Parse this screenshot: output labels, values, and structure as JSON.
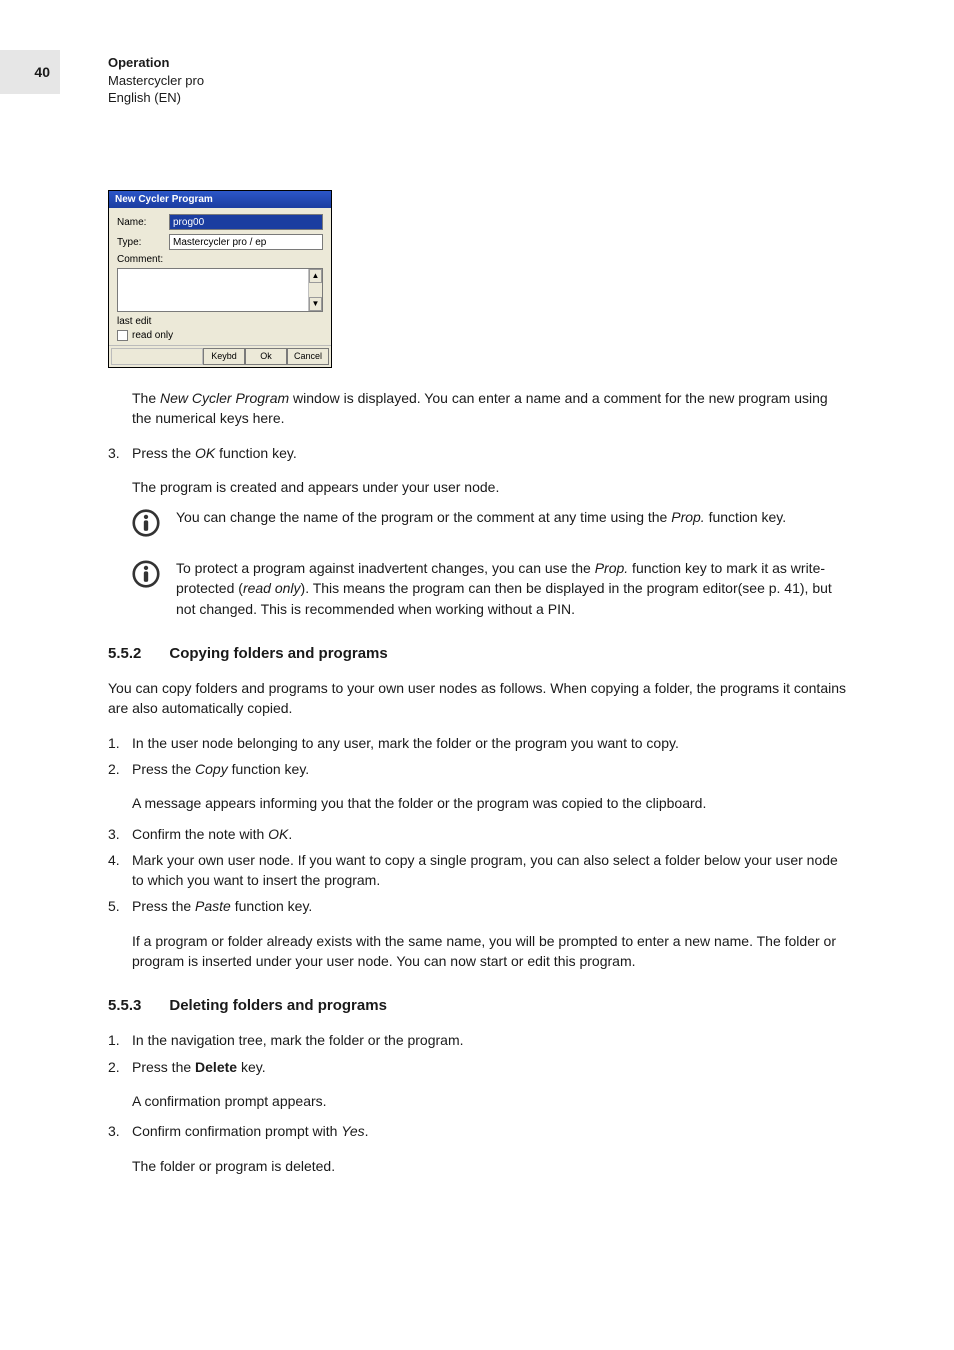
{
  "page_number": "40",
  "header": {
    "title": "Operation",
    "line2": "Mastercycler pro",
    "line3": "English (EN)"
  },
  "dialog": {
    "title": "New Cycler Program",
    "labels": {
      "name": "Name:",
      "type": "Type:",
      "comment": "Comment:",
      "last_edit": "last edit",
      "read_only": "read only"
    },
    "values": {
      "name": "prog00",
      "type": "Mastercycler pro / ep"
    },
    "buttons": {
      "keybd": "Keybd",
      "ok": "Ok",
      "cancel": "Cancel"
    }
  },
  "body": {
    "p1_a": "The ",
    "p1_b": "New Cycler Program",
    "p1_c": " window is displayed. You can enter a name and a comment for the new program using the numerical keys here.",
    "step3_num": "3.",
    "step3_a": "Press the ",
    "step3_b": "OK",
    "step3_c": " function key.",
    "step3_sub": "The program is created and appears under your user node.",
    "info1_a": "You can change the name of the program or the comment at any time using the ",
    "info1_b": "Prop.",
    "info1_c": " function key.",
    "info2_a": "To protect a program against inadvertent changes, you can use the ",
    "info2_b": "Prop.",
    "info2_c": " function key to mark it as write-protected (",
    "info2_d": "read only",
    "info2_e": "). This means the program can then be displayed in the program editor(see p. 41), but not changed. This is recommended when working without a PIN."
  },
  "sec552": {
    "num": "5.5.2",
    "title": "Copying folders and programs",
    "intro": "You can copy folders and programs to your own user nodes as follows. When copying a folder, the programs it contains are also automatically copied.",
    "s1_num": "1.",
    "s1": "In the user node belonging to any user, mark the folder or the program you want to copy.",
    "s2_num": "2.",
    "s2_a": "Press the ",
    "s2_b": "Copy",
    "s2_c": " function key.",
    "s2_sub": "A message appears informing you that the folder or the program was copied to the clipboard.",
    "s3_num": "3.",
    "s3_a": "Confirm the note with ",
    "s3_b": "OK",
    "s3_c": ".",
    "s4_num": "4.",
    "s4": "Mark your own user node. If you want to copy a single program, you can also select a folder below your user node to which you want to insert the program.",
    "s5_num": "5.",
    "s5_a": "Press the ",
    "s5_b": "Paste",
    "s5_c": " function key.",
    "s5_sub": "If a program or folder already exists with the same name, you will be prompted to enter a new name. The folder or program is inserted under your user node. You can now start or edit this program."
  },
  "sec553": {
    "num": "5.5.3",
    "title": "Deleting folders and programs",
    "s1_num": "1.",
    "s1": "In the navigation tree, mark the folder or the program.",
    "s2_num": "2.",
    "s2_a": "Press the ",
    "s2_b": "Delete",
    "s2_c": " key.",
    "s2_sub": "A confirmation prompt appears.",
    "s3_num": "3.",
    "s3_a": "Confirm confirmation prompt with ",
    "s3_b": "Yes",
    "s3_c": ".",
    "s3_sub": "The folder or program is deleted."
  }
}
